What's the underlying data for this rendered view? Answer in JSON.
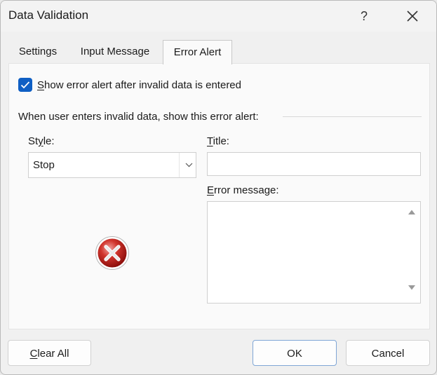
{
  "window": {
    "title": "Data Validation",
    "help_label": "?"
  },
  "tabs": [
    {
      "label": "Settings",
      "active": false
    },
    {
      "label": "Input Message",
      "active": false
    },
    {
      "label": "Error Alert",
      "active": true
    }
  ],
  "error_alert": {
    "show_alert": {
      "checked": true,
      "label_first": "S",
      "label_rest": "how error alert after invalid data is entered"
    },
    "group_label": "When user enters invalid data, show this error alert:",
    "style": {
      "label_pre": "St",
      "label_u": "y",
      "label_post": "le:",
      "selected": "Stop",
      "icon": "stop-error-icon"
    },
    "title": {
      "label_u": "T",
      "label_rest": "itle:",
      "value": ""
    },
    "error_message": {
      "label_u": "E",
      "label_rest": "rror message:",
      "value": ""
    }
  },
  "buttons": {
    "clear_all_u": "C",
    "clear_all_rest": "lear All",
    "ok": "OK",
    "cancel": "Cancel"
  },
  "colors": {
    "accent": "#0f5fc4",
    "stop_red": "#c8102e"
  }
}
